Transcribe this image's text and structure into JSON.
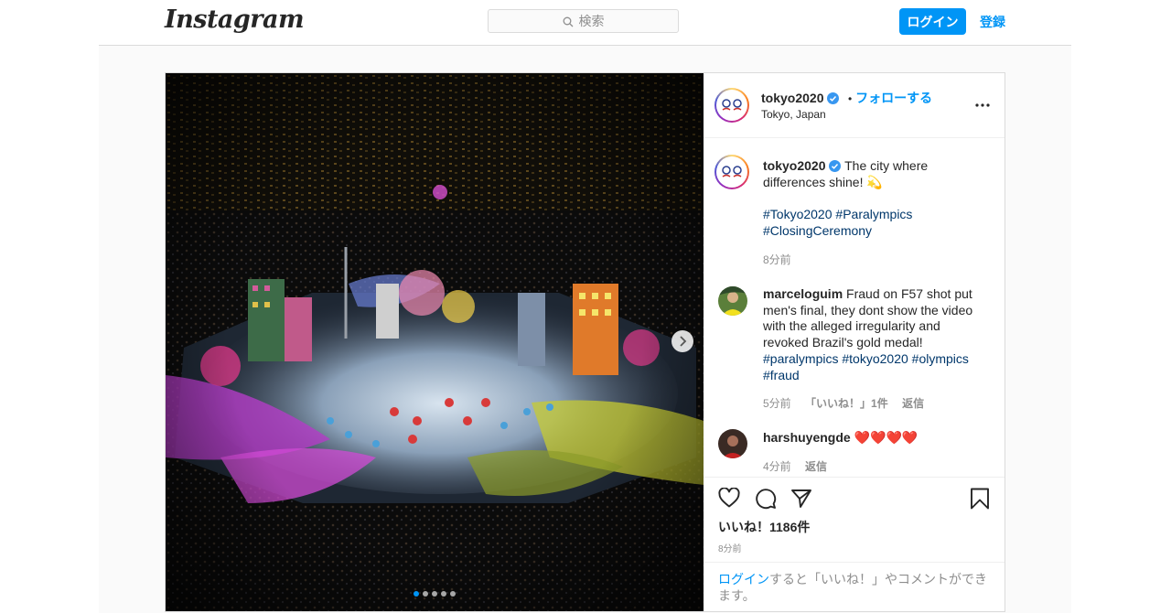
{
  "header": {
    "logo_text": "Instagram",
    "search_placeholder": "検索",
    "login_label": "ログイン",
    "signup_label": "登録"
  },
  "post": {
    "username": "tokyo2020",
    "follow_separator": "•",
    "follow_label": "フォローする",
    "location": "Tokyo, Japan",
    "carousel_total": 5,
    "carousel_active": 1
  },
  "caption": {
    "username": "tokyo2020",
    "text_line1": "The city where",
    "text_line2": "differences shine!",
    "emoji": "💫",
    "hashtags_line1": [
      "#Tokyo2020",
      "#Paralympics"
    ],
    "hashtags_line2": [
      "#ClosingCeremony"
    ],
    "time": "8分前"
  },
  "comments": [
    {
      "username": "marceloguim",
      "text": "Fraud on F57 shot put men's final, they dont show the video with the alleged irregularity and revoked Brazil's gold medal!",
      "hashtags_line1": [
        "#paralympics",
        "#tokyo2020",
        "#olympics"
      ],
      "hashtags_line2": [
        "#fraud"
      ],
      "time": "5分前",
      "likes": "「いいね！」1件",
      "reply_label": "返信"
    },
    {
      "username": "harshuyengde",
      "text": "❤️❤️❤️❤️",
      "time": "4分前",
      "reply_label": "返信"
    }
  ],
  "footer": {
    "likes_text": "いいね！1186件",
    "post_time": "8分前",
    "login_link": "ログイン",
    "login_suffix": "すると「いいね！」やコメントができます。"
  },
  "icons": {
    "search": "search-icon",
    "verified": "verified-badge-icon",
    "more": "more-options-icon",
    "next": "chevron-right-icon",
    "like": "heart-icon",
    "comment": "comment-icon",
    "share": "share-icon",
    "save": "bookmark-icon"
  },
  "colors": {
    "accent": "#0095f6",
    "border": "#dbdbdb",
    "hashtag": "#00376b",
    "muted": "#8e8e8e",
    "text": "#262626"
  }
}
